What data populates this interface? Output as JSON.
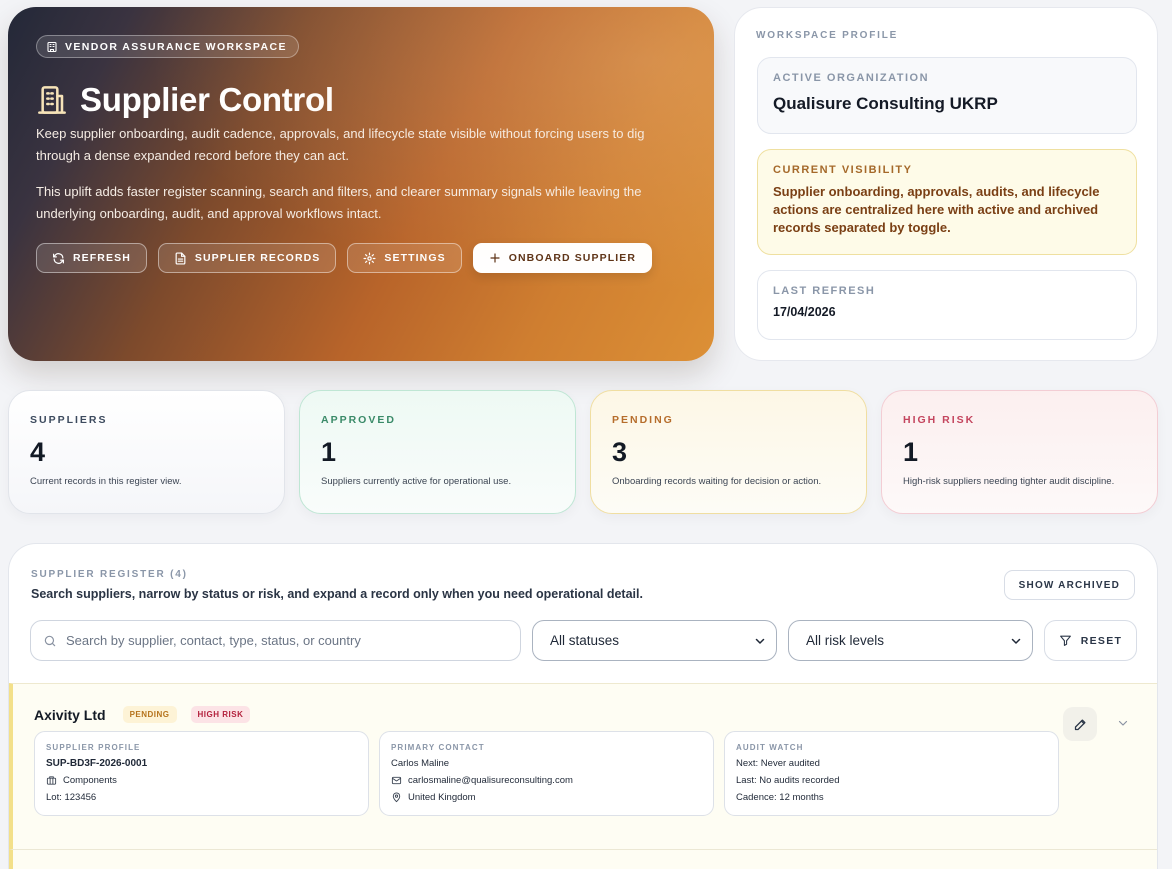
{
  "hero": {
    "badge": "VENDOR ASSURANCE WORKSPACE",
    "title": "Supplier Control",
    "paragraph1": "Keep supplier onboarding, audit cadence, approvals, and lifecycle state visible without forcing users to dig through a dense expanded record before they can act.",
    "paragraph2": "This uplift adds faster register scanning, search and filters, and clearer summary signals while leaving the underlying onboarding, audit, and approval workflows intact.",
    "buttons": {
      "refresh": "REFRESH",
      "supplier_records": "SUPPLIER RECORDS",
      "settings": "SETTINGS",
      "onboard": "ONBOARD SUPPLIER"
    }
  },
  "profile": {
    "section_label": "WORKSPACE PROFILE",
    "org_label": "ACTIVE ORGANIZATION",
    "org_value": "Qualisure Consulting UKRP",
    "visibility_label": "CURRENT VISIBILITY",
    "visibility_value": "Supplier onboarding, approvals, audits, and lifecycle actions are centralized here with active and archived records separated by toggle.",
    "refresh_label": "LAST REFRESH",
    "refresh_value": "17/04/2026"
  },
  "stats": [
    {
      "label": "SUPPLIERS",
      "value": "4",
      "desc": "Current records in this register view."
    },
    {
      "label": "APPROVED",
      "value": "1",
      "desc": "Suppliers currently active for operational use."
    },
    {
      "label": "PENDING",
      "value": "3",
      "desc": "Onboarding records waiting for decision or action."
    },
    {
      "label": "HIGH RISK",
      "value": "1",
      "desc": "High-risk suppliers needing tighter audit discipline."
    }
  ],
  "register": {
    "section_label": "SUPPLIER REGISTER (4)",
    "subtitle": "Search suppliers, narrow by status or risk, and expand a record only when you need operational detail.",
    "show_archived": "SHOW ARCHIVED",
    "search_placeholder": "Search by supplier, contact, type, status, or country",
    "status_filter": "All statuses",
    "risk_filter": "All risk levels",
    "reset": "RESET",
    "rows": [
      {
        "name": "Axivity Ltd",
        "status_tag": "PENDING",
        "risk_tag": "HIGH RISK",
        "profile_label": "SUPPLIER PROFILE",
        "supplier_id": "SUP-BD3F-2026-0001",
        "type": "Components",
        "lot": "Lot: 123456",
        "contact_label": "PRIMARY CONTACT",
        "contact_name": "Carlos Maline",
        "contact_email": "carlosmaline@qualisureconsulting.com",
        "contact_country": "United Kingdom",
        "audit_label": "AUDIT WATCH",
        "audit_next": "Next: Never audited",
        "audit_last": "Last: No audits recorded",
        "audit_cadence": "Cadence: 12 months"
      }
    ]
  },
  "colors": {
    "hero_gradient_start": "#232838",
    "hero_gradient_end": "#dc9036",
    "approved": "#3a8a68",
    "pending": "#b66d2c",
    "high_risk": "#c4455e",
    "pending_row_accent": "#f3e08a"
  }
}
